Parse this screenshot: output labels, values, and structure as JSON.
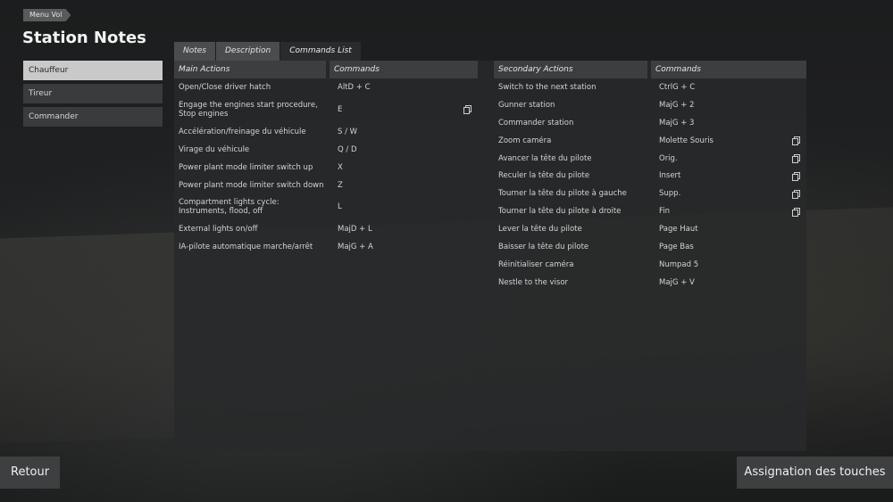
{
  "breadcrumb": "Menu Vol",
  "page_title": "Station Notes",
  "sidebar": {
    "items": [
      {
        "label": "Chauffeur",
        "active": true
      },
      {
        "label": "Tireur",
        "active": false
      },
      {
        "label": "Commander",
        "active": false
      }
    ]
  },
  "tabs": [
    {
      "label": "Notes",
      "active": false
    },
    {
      "label": "Description",
      "active": false
    },
    {
      "label": "Commands List",
      "active": true
    }
  ],
  "main_table": {
    "headers": {
      "action": "Main Actions",
      "command": "Commands"
    },
    "rows": [
      {
        "action": "Open/Close driver hatch",
        "command": "AltD + C"
      },
      {
        "action": "Engage the engines start procedure, Stop engines",
        "command": "E",
        "icon": "copy-icon"
      },
      {
        "action": "Accélération/freinage du véhicule",
        "command": "S / W"
      },
      {
        "action": "Virage du véhicule",
        "command": "Q / D"
      },
      {
        "action": "Power plant mode limiter switch up",
        "command": "X"
      },
      {
        "action": "Power plant mode limiter switch down",
        "command": "Z"
      },
      {
        "action": "Compartment lights cycle: Instruments, flood, off",
        "command": "L"
      },
      {
        "action": "External lights on/off",
        "command": "MajD + L"
      },
      {
        "action": "IA-pilote automatique marche/arrêt",
        "command": "MajG + A"
      }
    ]
  },
  "secondary_table": {
    "headers": {
      "action": "Secondary Actions",
      "command": "Commands"
    },
    "rows": [
      {
        "action": "Switch to the next station",
        "command": "CtrlG + C"
      },
      {
        "action": "Gunner station",
        "command": "MajG + 2"
      },
      {
        "action": "Commander station",
        "command": "MajG + 3"
      },
      {
        "action": "Zoom caméra",
        "command": "Molette Souris",
        "icon": "copy-icon"
      },
      {
        "action": "Avancer la tête du pilote",
        "command": "Orig.",
        "icon": "copy-icon"
      },
      {
        "action": "Reculer la tête du pilote",
        "command": "Insert",
        "icon": "copy-icon"
      },
      {
        "action": "Tourner la tête du pilote à gauche",
        "command": "Supp.",
        "icon": "copy-icon"
      },
      {
        "action": "Tourner la tête du pilote à droite",
        "command": "Fin",
        "icon": "copy-icon"
      },
      {
        "action": "Lever la tête du pilote",
        "command": "Page Haut"
      },
      {
        "action": "Baisser la tête du pilote",
        "command": "Page Bas"
      },
      {
        "action": "Réinitialiser caméra",
        "command": "Numpad 5"
      },
      {
        "action": "Nestle to the visor",
        "command": "MajG + V"
      }
    ]
  },
  "buttons": {
    "back": "Retour",
    "key_assignment": "Assignation des touches"
  }
}
